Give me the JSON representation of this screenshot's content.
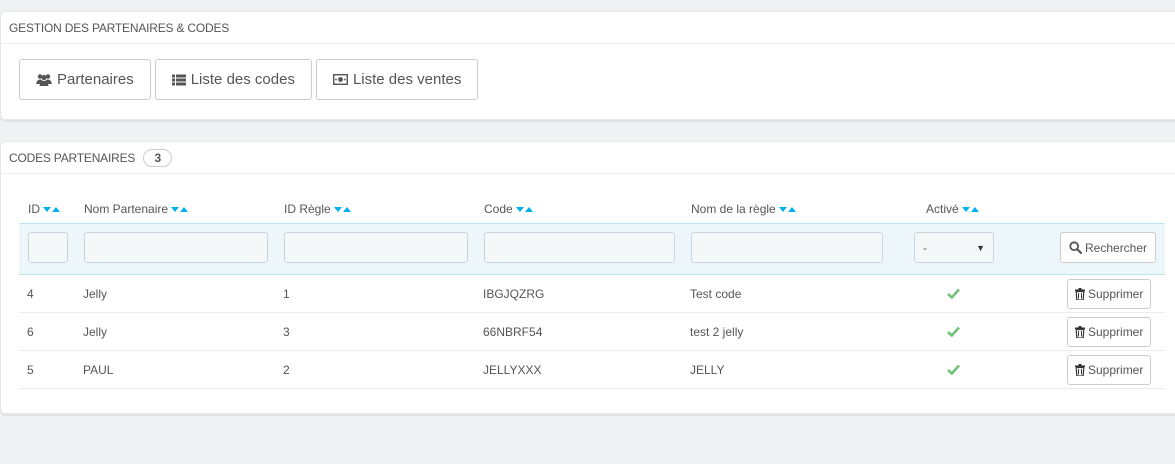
{
  "panel_partners": {
    "title": "GESTION DES PARTENAIRES & CODES",
    "buttons": [
      {
        "label": "Partenaires",
        "icon": "users-icon"
      },
      {
        "label": "Liste des codes",
        "icon": "list-icon"
      },
      {
        "label": "Liste des ventes",
        "icon": "money-icon"
      }
    ]
  },
  "panel_codes": {
    "title": "CODES PARTENAIRES",
    "count": "3",
    "columns": [
      "ID",
      "Nom Partenaire",
      "ID Règle",
      "Code",
      "Nom de la règle",
      "Activé"
    ],
    "filter": {
      "active_value": "-",
      "search_label": "Rechercher"
    },
    "rows": [
      {
        "id": "4",
        "partner": "Jelly",
        "rule_id": "1",
        "code": "IBGJQZRG",
        "rule_name": "Test code",
        "active": true
      },
      {
        "id": "6",
        "partner": "Jelly",
        "rule_id": "3",
        "code": "66NBRF54",
        "rule_name": "test 2 jelly",
        "active": true
      },
      {
        "id": "5",
        "partner": "PAUL",
        "rule_id": "2",
        "code": "JELLYXXX",
        "rule_name": "JELLY",
        "active": true
      }
    ],
    "delete_label": "Supprimer"
  },
  "colors": {
    "accent": "#00aff0",
    "check": "#72c279",
    "background": "#eff1f2"
  }
}
